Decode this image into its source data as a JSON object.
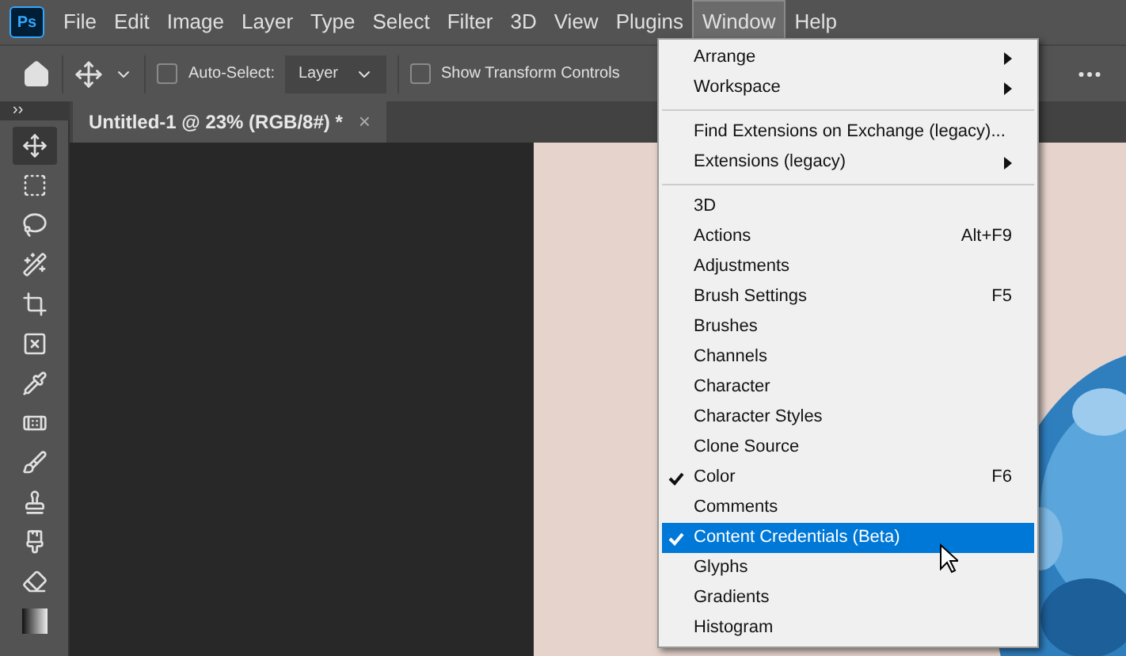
{
  "app_logo": "Ps",
  "menu_bar": [
    {
      "label": "File",
      "selected": false
    },
    {
      "label": "Edit",
      "selected": false
    },
    {
      "label": "Image",
      "selected": false
    },
    {
      "label": "Layer",
      "selected": false
    },
    {
      "label": "Type",
      "selected": false
    },
    {
      "label": "Select",
      "selected": false
    },
    {
      "label": "Filter",
      "selected": false
    },
    {
      "label": "3D",
      "selected": false
    },
    {
      "label": "View",
      "selected": false
    },
    {
      "label": "Plugins",
      "selected": false
    },
    {
      "label": "Window",
      "selected": true
    },
    {
      "label": "Help",
      "selected": false
    }
  ],
  "options_bar": {
    "auto_select": {
      "label": "Auto-Select:",
      "checked": false
    },
    "target": {
      "value": "Layer"
    },
    "show_transform": {
      "label": "Show Transform Controls",
      "checked": false
    }
  },
  "panel_toggle": "››",
  "document_tab": {
    "title": "Untitled-1 @ 23% (RGB/8#) *",
    "close": "×"
  },
  "tools": [
    {
      "selected": true
    },
    {
      "selected": false
    },
    {
      "selected": false
    },
    {
      "selected": false
    },
    {
      "selected": false
    },
    {
      "selected": false
    },
    {
      "selected": false
    },
    {
      "selected": false
    },
    {
      "selected": false
    },
    {
      "selected": false
    },
    {
      "selected": false
    },
    {
      "selected": false
    },
    {
      "selected": false
    }
  ],
  "document": {
    "kind": "picture"
  },
  "window_menu": [
    [
      {
        "label": "Arrange",
        "submenu": true,
        "checked": false,
        "selected": false
      },
      {
        "label": "Workspace",
        "submenu": true,
        "checked": false,
        "selected": false
      }
    ],
    [
      {
        "label": "Find Extensions on Exchange (legacy)...",
        "submenu": false,
        "checked": false,
        "selected": false
      },
      {
        "label": "Extensions (legacy)",
        "submenu": true,
        "checked": false,
        "selected": false
      }
    ],
    [
      {
        "label": "3D",
        "submenu": false,
        "checked": false,
        "selected": false
      },
      {
        "label": "Actions",
        "shortcut": "Alt+F9",
        "submenu": false,
        "checked": false,
        "selected": false
      },
      {
        "label": "Adjustments",
        "submenu": false,
        "checked": false,
        "selected": false
      },
      {
        "label": "Brush Settings",
        "shortcut": "F5",
        "submenu": false,
        "checked": false,
        "selected": false
      },
      {
        "label": "Brushes",
        "submenu": false,
        "checked": false,
        "selected": false
      },
      {
        "label": "Channels",
        "submenu": false,
        "checked": false,
        "selected": false
      },
      {
        "label": "Character",
        "submenu": false,
        "checked": false,
        "selected": false
      },
      {
        "label": "Character Styles",
        "submenu": false,
        "checked": false,
        "selected": false
      },
      {
        "label": "Clone Source",
        "submenu": false,
        "checked": false,
        "selected": false
      },
      {
        "label": "Color",
        "shortcut": "F6",
        "submenu": false,
        "checked": true,
        "selected": false
      },
      {
        "label": "Comments",
        "submenu": false,
        "checked": false,
        "selected": false
      },
      {
        "label": "Content Credentials (Beta)",
        "submenu": false,
        "checked": true,
        "selected": true
      },
      {
        "label": "Glyphs",
        "submenu": false,
        "checked": false,
        "selected": false
      },
      {
        "label": "Gradients",
        "submenu": false,
        "checked": false,
        "selected": false
      },
      {
        "label": "Histogram",
        "submenu": false,
        "checked": false,
        "selected": false
      }
    ]
  ]
}
